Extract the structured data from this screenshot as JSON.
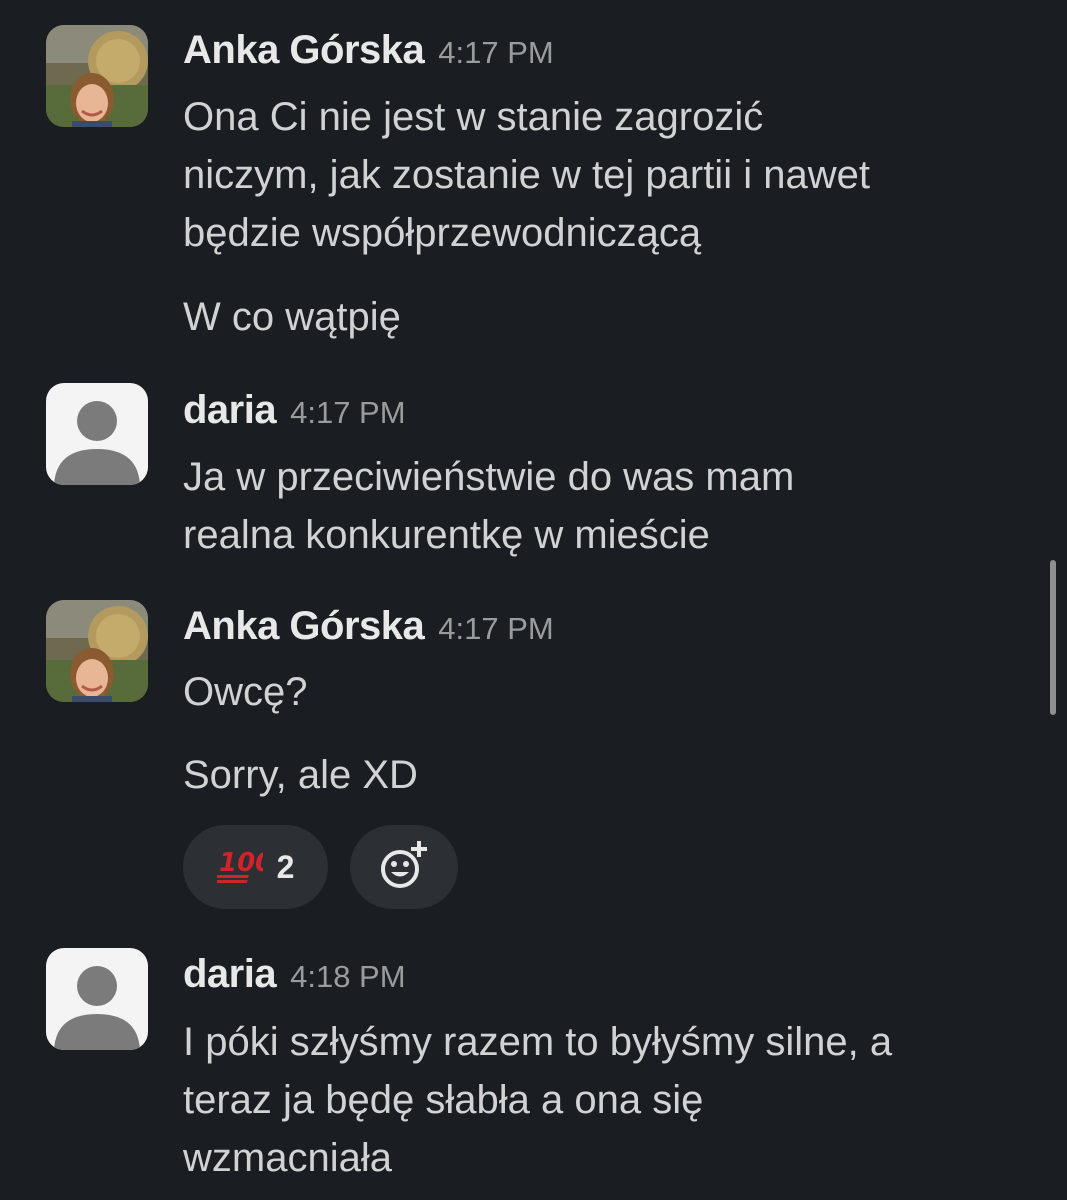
{
  "messages": [
    {
      "author": "Anka Górska",
      "time": "4:17 PM",
      "lines": [
        "Ona Ci nie jest w stanie zagrozić",
        "niczym, jak zostanie w tej partii i nawet",
        "będzie współprzewodniczącą"
      ],
      "followup": "W co wątpię"
    },
    {
      "author": "daria",
      "time": "4:17 PM",
      "lines": [
        "Ja w przeciwieństwie do was mam",
        "realna konkurentkę w mieście"
      ]
    },
    {
      "author": "Anka Górska",
      "time": "4:17 PM",
      "lines": [
        "Owcę?"
      ],
      "followup": "Sorry, ale XD",
      "reactions": [
        {
          "emoji": "💯",
          "icon": "hundred-points-icon",
          "count": "2"
        }
      ],
      "add_reaction_icon": "add-emoji-icon"
    },
    {
      "author": "daria",
      "time": "4:18 PM",
      "lines": [
        "I póki szłyśmy razem to byłyśmy silne, a",
        "teraz ja będę słabła a ona się",
        "wzmacniała"
      ]
    }
  ],
  "colors": {
    "background": "#1a1d21",
    "text": "#d1d2d3",
    "author": "#e8e8e8",
    "timestamp": "#9a9b9d",
    "reaction_bg": "#2c2f34",
    "hundred_red": "#d3222a"
  }
}
